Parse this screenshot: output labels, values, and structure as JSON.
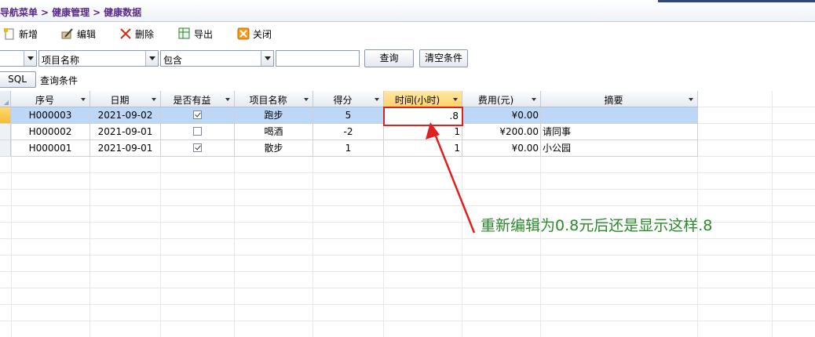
{
  "breadcrumb": {
    "items": [
      "导航菜单",
      "健康管理",
      "健康数据"
    ],
    "separator": ">"
  },
  "toolbar": {
    "new_label": "新增",
    "edit_label": "编辑",
    "delete_label": "删除",
    "export_label": "导出",
    "close_label": "关闭"
  },
  "filter": {
    "field_combo_value": "项目名称",
    "operator_combo_value": "包含",
    "search_value": "",
    "query_button": "查询",
    "clear_button": "清空条件"
  },
  "sql": {
    "button": "SQL",
    "label": "查询条件"
  },
  "grid": {
    "columns": [
      "序号",
      "日期",
      "是否有益",
      "项目名称",
      "得分",
      "时间(小时)",
      "费用(元)",
      "摘要"
    ],
    "active_column": "时间(小时)",
    "rows": [
      {
        "id": "H000003",
        "date": "2021-09-02",
        "beneficial": true,
        "item": "跑步",
        "score": "5",
        "hours": ".8",
        "cost": "¥0.00",
        "summary": ""
      },
      {
        "id": "H000002",
        "date": "2021-09-01",
        "beneficial": false,
        "item": "喝酒",
        "score": "-2",
        "hours": "1",
        "cost": "¥200.00",
        "summary": "请同事"
      },
      {
        "id": "H000001",
        "date": "2021-09-01",
        "beneficial": true,
        "item": "散步",
        "score": "1",
        "hours": "1",
        "cost": "¥0.00",
        "summary": "小公园"
      }
    ]
  },
  "annotation": {
    "text": "重新编辑为0.8元后还是显示这样.8",
    "color": "#2a8a2a",
    "box_color": "#e02020"
  }
}
